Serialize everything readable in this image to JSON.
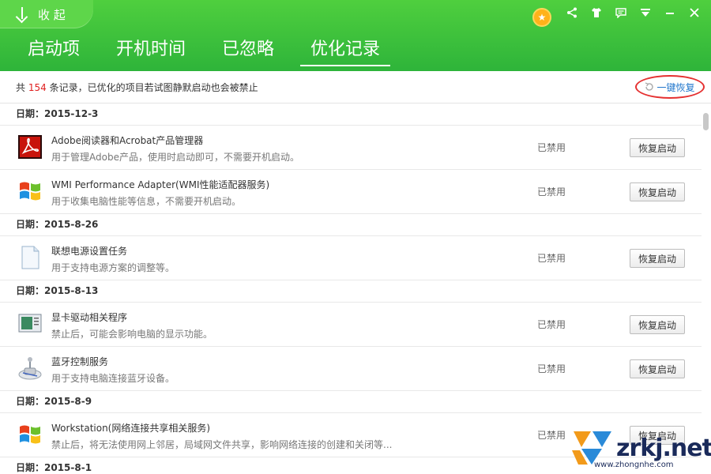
{
  "header": {
    "collapse_label": "收 起",
    "tabs": [
      {
        "label": "启动项"
      },
      {
        "label": "开机时间"
      },
      {
        "label": "已忽略"
      },
      {
        "label": "优化记录"
      }
    ]
  },
  "info": {
    "prefix": "共",
    "count": "154",
    "suffix": "条记录，已优化的项目若试图静默启动也会被禁止",
    "restore_all": "一键恢复"
  },
  "groups": [
    {
      "date": "日期：2015-12-3",
      "items": [
        {
          "title": "Adobe阅读器和Acrobat产品管理器",
          "desc": "用于管理Adobe产品，使用时启动即可，不需要开机启动。",
          "status": "已禁用",
          "button": "恢复启动",
          "icon": "adobe-icon"
        },
        {
          "title": "WMI Performance Adapter(WMI性能适配器服务)",
          "desc": "用于收集电脑性能等信息，不需要开机启动。",
          "status": "已禁用",
          "button": "恢复启动",
          "icon": "windows-icon"
        }
      ]
    },
    {
      "date": "日期：2015-8-26",
      "items": [
        {
          "title": "联想电源设置任务",
          "desc": "用于支持电源方案的调整等。",
          "status": "已禁用",
          "button": "恢复启动",
          "icon": "document-icon"
        }
      ]
    },
    {
      "date": "日期：2015-8-13",
      "items": [
        {
          "title": "显卡驱动相关程序",
          "desc": "禁止后，可能会影响电脑的显示功能。",
          "status": "已禁用",
          "button": "恢复启动",
          "icon": "display-driver-icon"
        },
        {
          "title": "蓝牙控制服务",
          "desc": "用于支持电脑连接蓝牙设备。",
          "status": "已禁用",
          "button": "恢复启动",
          "icon": "bluetooth-device-icon"
        }
      ]
    },
    {
      "date": "日期：2015-8-9",
      "items": [
        {
          "title": "Workstation(网络连接共享相关服务)",
          "desc": "禁止后，将无法使用网上邻居，局域网文件共享，影响网络连接的创建和关闭等...",
          "status": "已禁用",
          "button": "恢复启动",
          "icon": "windows-icon"
        }
      ]
    },
    {
      "date": "日期：2015-8-1",
      "items": []
    }
  ],
  "watermark": {
    "domain": "zrkj.net",
    "sub": "www.zhongnhe.com"
  }
}
